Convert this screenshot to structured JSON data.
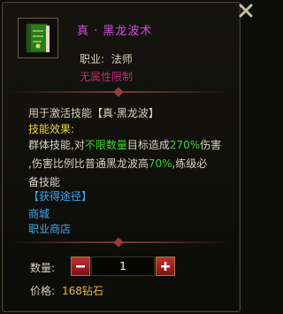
{
  "item": {
    "title": "真 · 黑龙波术",
    "job_label": "职业:",
    "job_value": "法师",
    "restriction": "无属性限制"
  },
  "details": {
    "use_for": "用于激活技能【真·黑龙波】",
    "effect_label": "技能效果:",
    "line1_a": "群体技能,对",
    "line1_b": "不限数量",
    "line1_c": "目标造成",
    "line1_d": "270%",
    "line1_e": "伤害",
    "line2_a": ",伤害比例比普通黑龙波高",
    "line2_b": "70%",
    "line2_c": ",练级必",
    "line3": "备技能",
    "get_header": "【获得途径】",
    "source1": "商城",
    "source2": "职业商店"
  },
  "purchase": {
    "qty_label": "数量:",
    "qty_value": "1",
    "price_label": "价格:",
    "price_value": "168钻石"
  },
  "icons": {
    "close": "close-icon",
    "book": "skill-book-icon",
    "minus": "minus-icon",
    "plus": "plus-icon"
  },
  "colors": {
    "title": "#d04ce0",
    "restriction": "#b72b75",
    "effect": "#e8d640",
    "highlight": "#3ad32e",
    "source": "#3fa9e8",
    "price": "#e8b93a"
  }
}
